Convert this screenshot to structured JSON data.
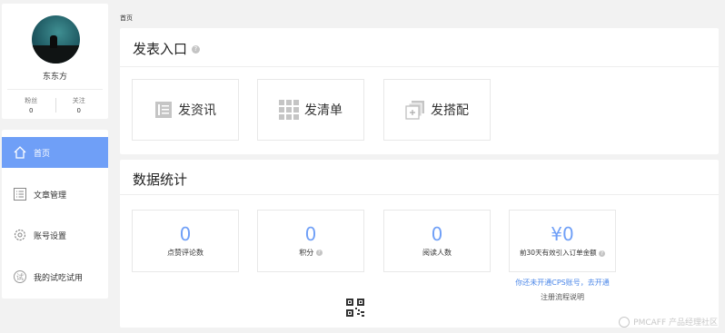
{
  "profile": {
    "username": "东东方",
    "fans_label": "粉丝",
    "fans_count": "0",
    "follow_label": "关注",
    "follow_count": "0"
  },
  "nav": {
    "items": [
      {
        "label": "首页",
        "icon": "home-icon",
        "active": true
      },
      {
        "label": "文章管理",
        "icon": "list-icon",
        "active": false
      },
      {
        "label": "账号设置",
        "icon": "gear-icon",
        "active": false
      },
      {
        "label": "我的试吃试用",
        "icon": "trial-icon",
        "active": false
      }
    ]
  },
  "breadcrumb": "首页",
  "publish": {
    "title": "发表入口",
    "help": "?",
    "cards": [
      {
        "label": "发资讯",
        "icon": "article-icon"
      },
      {
        "label": "发清单",
        "icon": "grid-icon"
      },
      {
        "label": "发搭配",
        "icon": "combo-icon"
      }
    ]
  },
  "statistics": {
    "title": "数据统计",
    "cards": [
      {
        "value": "0",
        "label": "点赞评论数",
        "help": ""
      },
      {
        "value": "0",
        "label": "积分",
        "help": "?"
      },
      {
        "value": "0",
        "label": "阅读人数",
        "help": ""
      },
      {
        "value": "¥0",
        "label": "前30天有效引入订单金额",
        "help": "?"
      }
    ],
    "cps_link": "你还未开通CPS账号，去开通",
    "cps_note": "注册流程说明"
  },
  "watermark": "PMCAFF 产品经理社区",
  "colors": {
    "accent": "#6f9ff7",
    "link": "#4a86e8",
    "background": "#f2f2f2"
  }
}
